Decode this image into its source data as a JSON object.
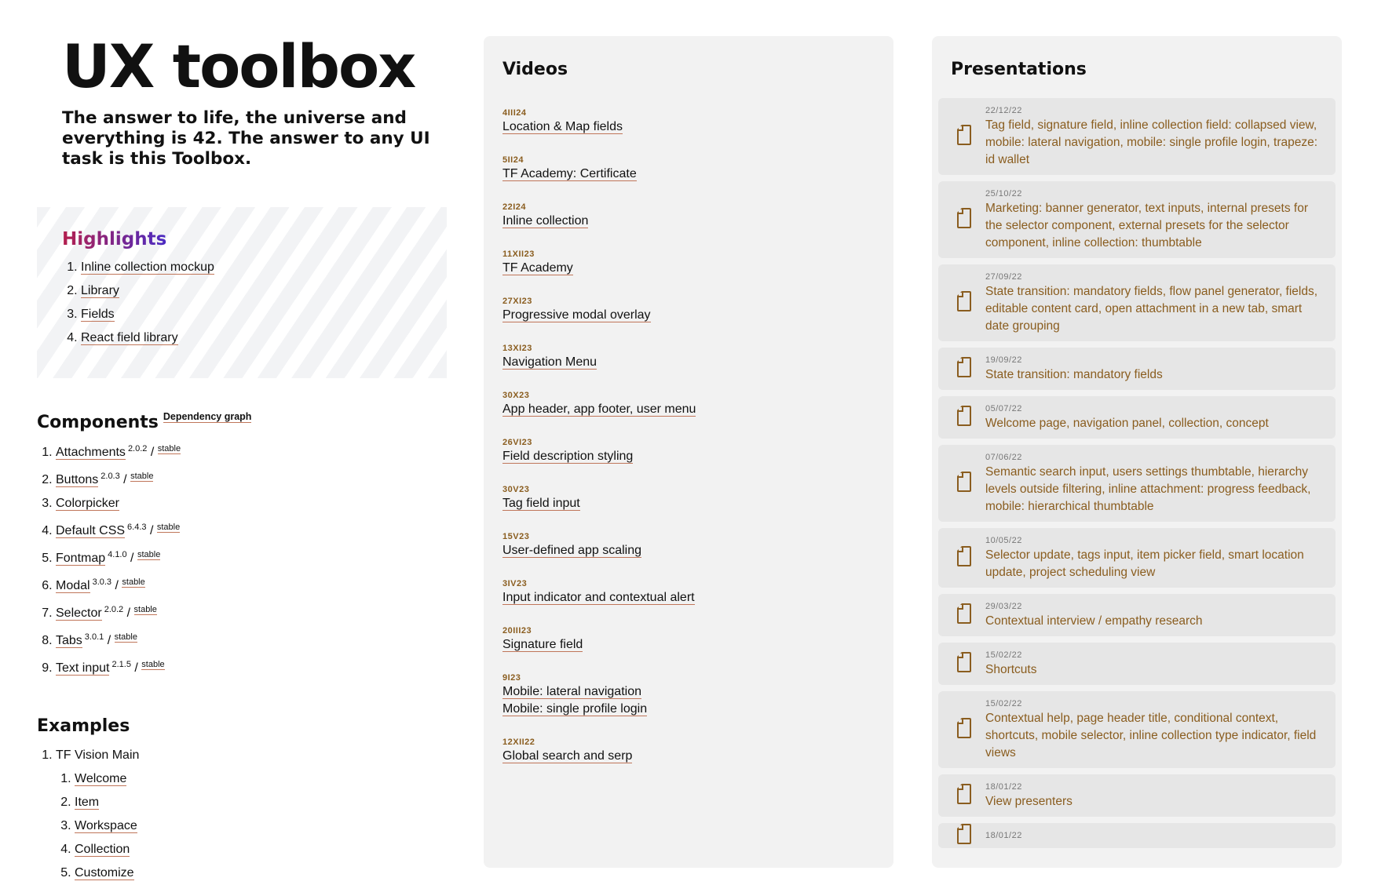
{
  "hero": {
    "title": "UX toolbox",
    "subtitle": "The answer to life, the universe and everything is 42. The answer to any UI task is this Toolbox."
  },
  "highlights": {
    "title": "Highlights",
    "items": [
      "Inline collection mockup",
      "Library",
      "Fields",
      "React field library"
    ]
  },
  "components": {
    "title": "Components",
    "dependency_link": "Dependency graph",
    "items": [
      {
        "name": "Attachments",
        "version": "2.0.2",
        "status": "stable"
      },
      {
        "name": "Buttons",
        "version": "2.0.3",
        "status": "stable"
      },
      {
        "name": "Colorpicker",
        "version": "",
        "status": ""
      },
      {
        "name": "Default CSS",
        "version": "6.4.3",
        "status": "stable"
      },
      {
        "name": "Fontmap",
        "version": "4.1.0",
        "status": "stable"
      },
      {
        "name": "Modal",
        "version": "3.0.3",
        "status": "stable"
      },
      {
        "name": "Selector",
        "version": "2.0.2",
        "status": "stable"
      },
      {
        "name": "Tabs",
        "version": "3.0.1",
        "status": "stable"
      },
      {
        "name": "Text input",
        "version": "2.1.5",
        "status": "stable"
      }
    ]
  },
  "examples": {
    "title": "Examples",
    "group": "TF Vision Main",
    "items": [
      "Welcome",
      "Item",
      "Workspace",
      "Collection",
      "Customize"
    ]
  },
  "videos": {
    "title": "Videos",
    "items": [
      {
        "date": "4III24",
        "titles": [
          "Location & Map fields"
        ]
      },
      {
        "date": "5II24",
        "titles": [
          "TF Academy: Certificate"
        ]
      },
      {
        "date": "22I24",
        "titles": [
          "Inline collection"
        ]
      },
      {
        "date": "11XII23",
        "titles": [
          "TF Academy"
        ]
      },
      {
        "date": "27XI23",
        "titles": [
          "Progressive modal overlay"
        ]
      },
      {
        "date": "13XI23",
        "titles": [
          "Navigation Menu"
        ]
      },
      {
        "date": "30X23",
        "titles": [
          "App header, app footer, user menu"
        ]
      },
      {
        "date": "26VI23",
        "titles": [
          "Field description styling"
        ]
      },
      {
        "date": "30V23",
        "titles": [
          "Tag field input"
        ]
      },
      {
        "date": "15V23",
        "titles": [
          "User-defined app scaling"
        ]
      },
      {
        "date": "3IV23",
        "titles": [
          "Input indicator and contextual alert"
        ]
      },
      {
        "date": "20III23",
        "titles": [
          "Signature field"
        ]
      },
      {
        "date": "9I23",
        "titles": [
          "Mobile: lateral navigation",
          "Mobile: single profile login"
        ]
      },
      {
        "date": "12XII22",
        "titles": [
          "Global search and serp"
        ]
      }
    ]
  },
  "presentations": {
    "title": "Presentations",
    "icon": "document-icon",
    "accent_color": "#8a5d1f",
    "items": [
      {
        "date": "22/12/22",
        "title": "Tag field, signature field, inline collection field: collapsed view, mobile: lateral navigation, mobile: single profile login, trapeze: id wallet"
      },
      {
        "date": "25/10/22",
        "title": "Marketing: banner generator, text inputs, internal presets for the selector component, external presets for the selector component, inline collection: thumbtable"
      },
      {
        "date": "27/09/22",
        "title": "State transition: mandatory fields, flow panel generator, fields, editable content card, open attachment in a new tab, smart date grouping"
      },
      {
        "date": "19/09/22",
        "title": "State transition: mandatory fields"
      },
      {
        "date": "05/07/22",
        "title": "Welcome page, navigation panel, collection, concept"
      },
      {
        "date": "07/06/22",
        "title": "Semantic search input, users settings thumbtable, hierarchy levels outside filtering, inline attachment: progress feedback, mobile: hierarchical thumbtable"
      },
      {
        "date": "10/05/22",
        "title": "Selector update, tags input, item picker field, smart location update, project scheduling view"
      },
      {
        "date": "29/03/22",
        "title": "Contextual interview / empathy research"
      },
      {
        "date": "15/02/22",
        "title": "Shortcuts"
      },
      {
        "date": "15/02/22",
        "title": "Contextual help, page header title, conditional context, shortcuts, mobile selector, inline collection type indicator, field views"
      },
      {
        "date": "18/01/22",
        "title": "View presenters"
      },
      {
        "date": "18/01/22",
        "title": ""
      }
    ]
  }
}
